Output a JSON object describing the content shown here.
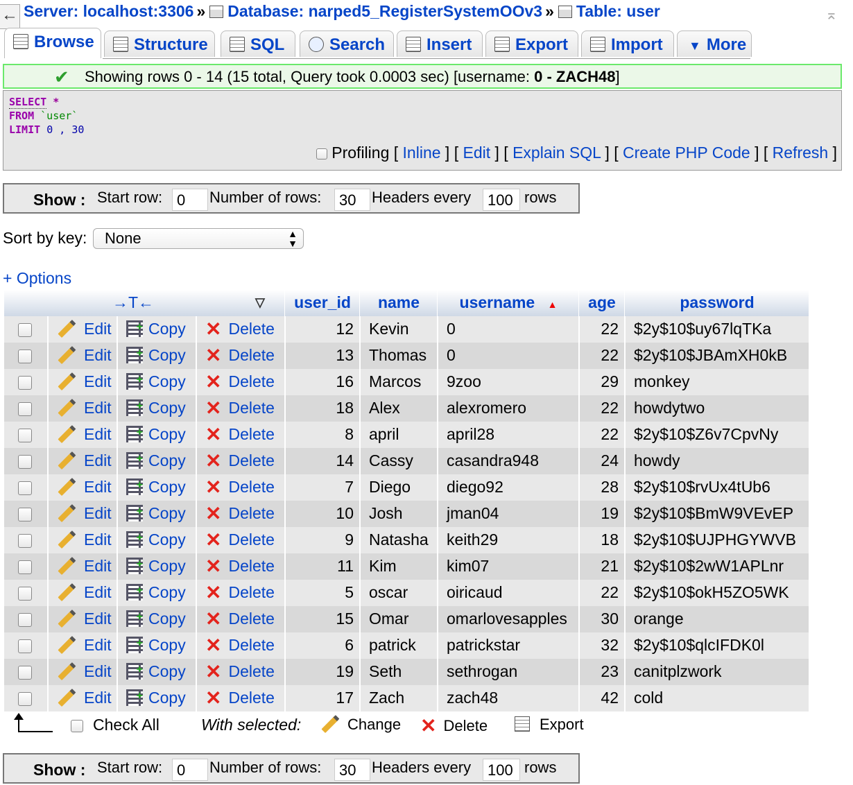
{
  "breadcrumb": {
    "server": "Server: localhost:3306",
    "database": "Database: narped5_RegisterSystemOOv3",
    "table": "Table: user",
    "sep": "»"
  },
  "tabs": [
    {
      "label": "Browse",
      "icon": "browse-icon"
    },
    {
      "label": "Structure",
      "icon": "structure-icon"
    },
    {
      "label": "SQL",
      "icon": "sql-icon"
    },
    {
      "label": "Search",
      "icon": "search-icon"
    },
    {
      "label": "Insert",
      "icon": "insert-icon"
    },
    {
      "label": "Export",
      "icon": "export-icon"
    },
    {
      "label": "Import",
      "icon": "import-icon"
    },
    {
      "label": "More",
      "icon": "chevron-down-icon"
    }
  ],
  "success": {
    "prefix": "Showing rows 0 - 14 (15 total, Query took 0.0003 sec) [username: ",
    "bold": "0 - ZACH48",
    "suffix": "]"
  },
  "sql": {
    "select_kw": "SELECT",
    "star": "*",
    "from_kw": "FROM",
    "table": "`user`",
    "limit_kw": "LIMIT",
    "limit_a": "0",
    "limit_sep": ",",
    "limit_b": "30"
  },
  "sql_options": {
    "profiling": "Profiling",
    "inline": "Inline",
    "edit": "Edit",
    "explain": "Explain SQL",
    "php": "Create PHP Code",
    "refresh": "Refresh"
  },
  "nav": {
    "show": "Show :",
    "start_row_label": "Start row:",
    "start_row": "0",
    "num_rows_label": "Number of rows:",
    "num_rows": "30",
    "headers_every_label": "Headers every",
    "headers_every": "100",
    "rows_label": "rows"
  },
  "sort": {
    "label": "Sort by key:",
    "value": "None"
  },
  "options_link": "+ Options",
  "columns": [
    "user_id",
    "name",
    "username",
    "age",
    "password"
  ],
  "row_actions": {
    "edit": "Edit",
    "copy": "Copy",
    "delete": "Delete"
  },
  "rows": [
    {
      "user_id": "12",
      "name": "Kevin",
      "username": "0",
      "age": "22",
      "password": "$2y$10$uy67lqTKa"
    },
    {
      "user_id": "13",
      "name": "Thomas",
      "username": "0",
      "age": "22",
      "password": "$2y$10$JBAmXH0kB"
    },
    {
      "user_id": "16",
      "name": "Marcos",
      "username": "9zoo",
      "age": "29",
      "password": "monkey"
    },
    {
      "user_id": "18",
      "name": "Alex",
      "username": "alexromero",
      "age": "22",
      "password": "howdytwo"
    },
    {
      "user_id": "8",
      "name": "april",
      "username": "april28",
      "age": "22",
      "password": "$2y$10$Z6v7CpvNy"
    },
    {
      "user_id": "14",
      "name": "Cassy",
      "username": "casandra948",
      "age": "24",
      "password": "howdy"
    },
    {
      "user_id": "7",
      "name": "Diego",
      "username": "diego92",
      "age": "28",
      "password": "$2y$10$rvUx4tUb6"
    },
    {
      "user_id": "10",
      "name": "Josh",
      "username": "jman04",
      "age": "19",
      "password": "$2y$10$BmW9VEvEP"
    },
    {
      "user_id": "9",
      "name": "Natasha",
      "username": "keith29",
      "age": "18",
      "password": "$2y$10$UJPHGYWVB"
    },
    {
      "user_id": "11",
      "name": "Kim",
      "username": "kim07",
      "age": "21",
      "password": "$2y$10$2wW1APLnr"
    },
    {
      "user_id": "5",
      "name": "oscar",
      "username": "oiricaud",
      "age": "22",
      "password": "$2y$10$okH5ZO5WK"
    },
    {
      "user_id": "15",
      "name": "Omar",
      "username": "omarlovesapples",
      "age": "30",
      "password": "orange"
    },
    {
      "user_id": "6",
      "name": "patrick",
      "username": "patrickstar",
      "age": "32",
      "password": "$2y$10$qlcIFDK0l"
    },
    {
      "user_id": "19",
      "name": "Seth",
      "username": "sethrogan",
      "age": "23",
      "password": "canitplzwork"
    },
    {
      "user_id": "17",
      "name": "Zach",
      "username": "zach48",
      "age": "42",
      "password": "cold"
    }
  ],
  "with_selected": {
    "check_all": "Check All",
    "label": "With selected:",
    "change": "Change",
    "delete": "Delete",
    "export": "Export"
  }
}
